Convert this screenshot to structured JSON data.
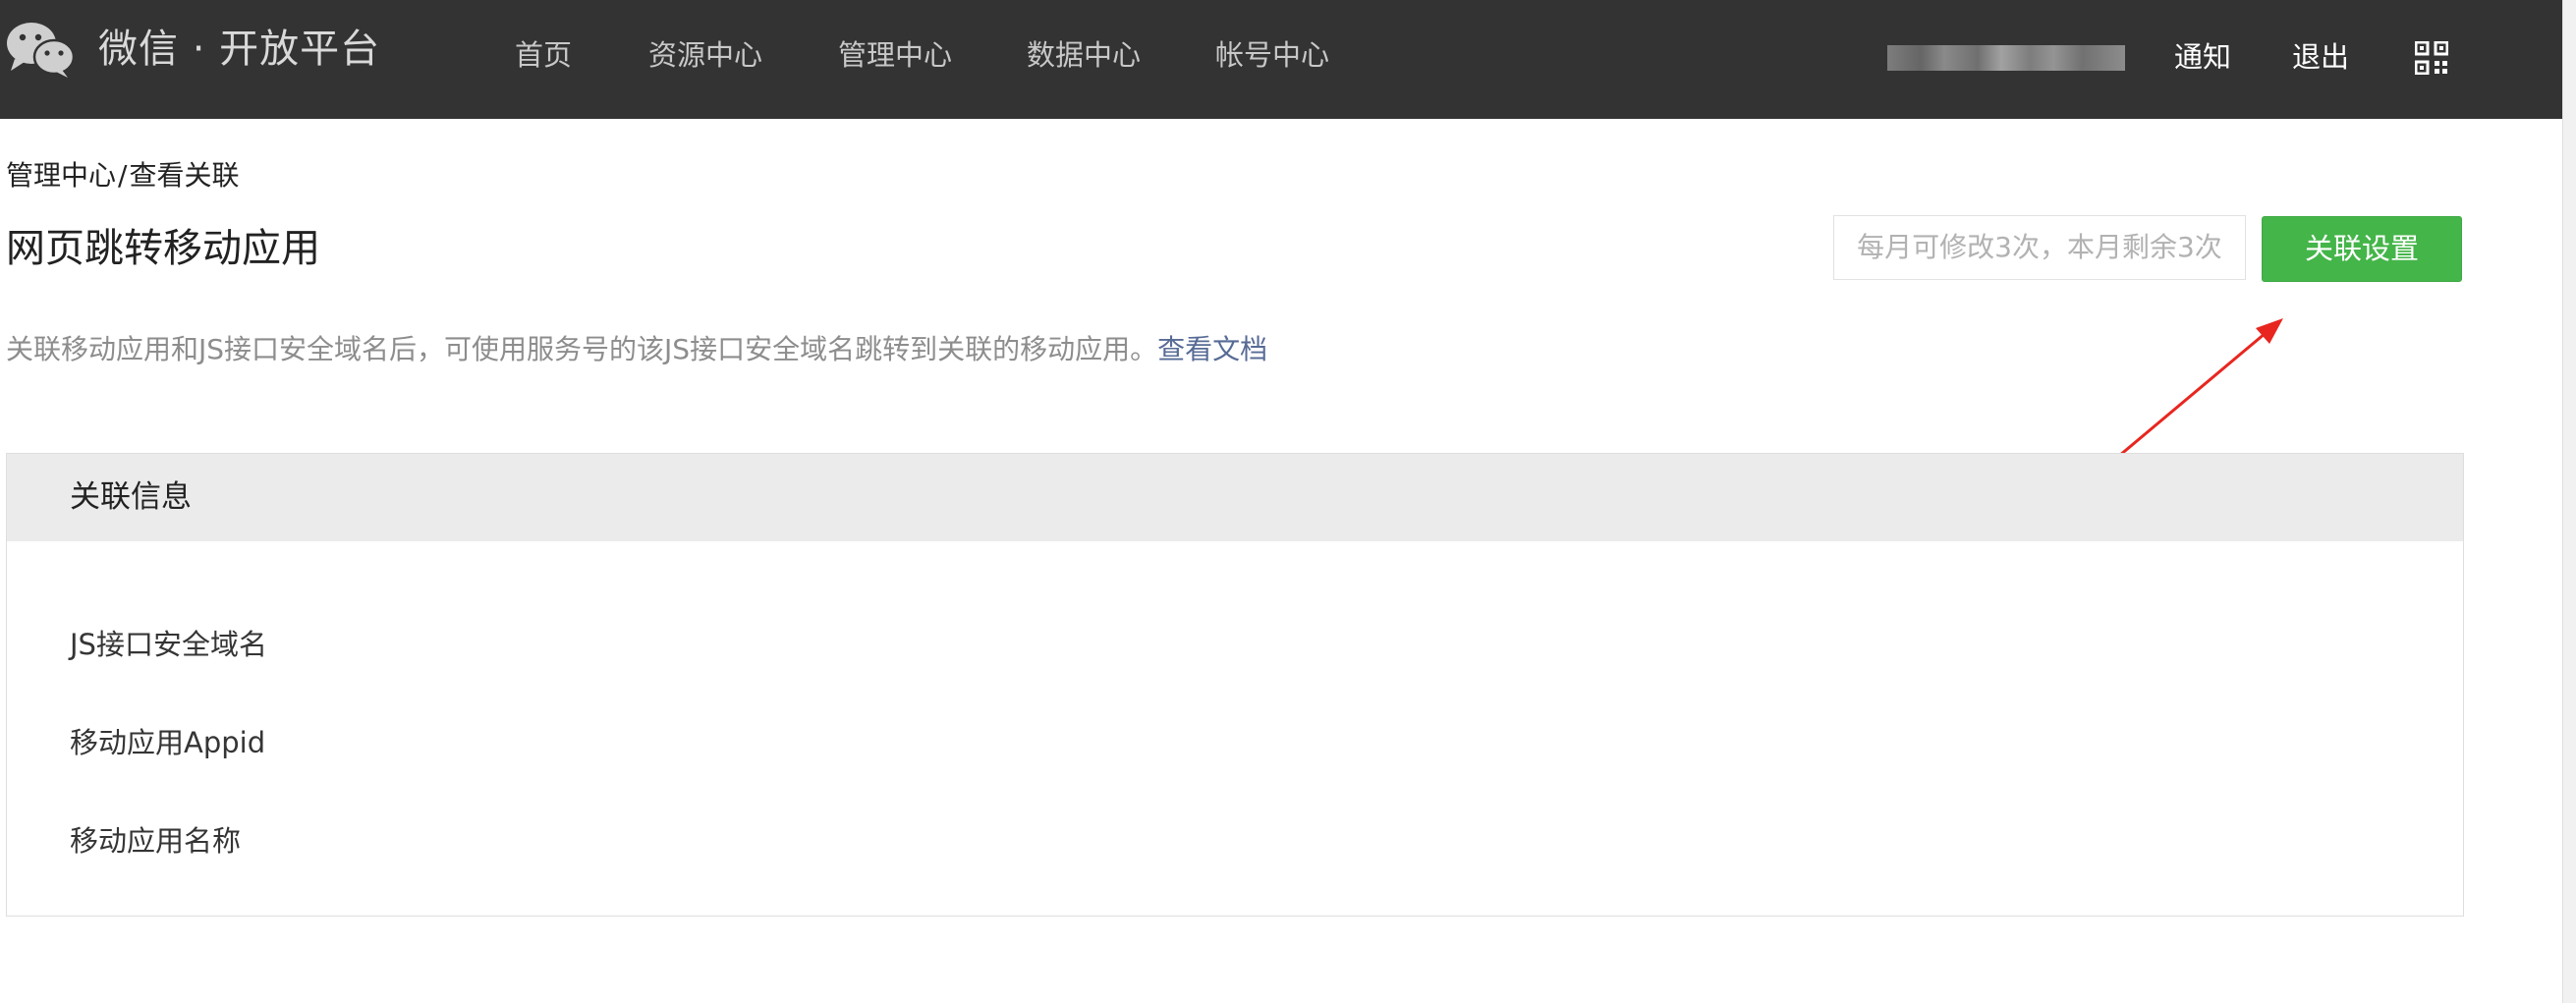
{
  "header": {
    "brand": "微信 · 开放平台",
    "nav": [
      "首页",
      "资源中心",
      "管理中心",
      "数据中心",
      "帐号中心"
    ],
    "notify_label": "通知",
    "logout_label": "退出"
  },
  "breadcrumb": {
    "parent": "管理中心",
    "separator": "/",
    "current": "查看关联"
  },
  "page": {
    "title": "网页跳转移动应用",
    "quota_text": "每月可修改3次，本月剩余3次",
    "settings_button": "关联设置",
    "description": "关联移动应用和JS接口安全域名后，可使用服务号的该JS接口安全域名跳转到关联的移动应用。",
    "doc_link": "查看文档"
  },
  "panel": {
    "title": "关联信息",
    "fields": [
      "JS接口安全域名",
      "移动应用Appid",
      "移动应用名称"
    ]
  },
  "colors": {
    "topbar": "#333333",
    "primary": "#44b549",
    "link": "#576b95",
    "annotation_arrow": "#e8261f"
  },
  "icons": {
    "logo": "wechat-logo-icon",
    "qr": "qrcode-icon"
  }
}
